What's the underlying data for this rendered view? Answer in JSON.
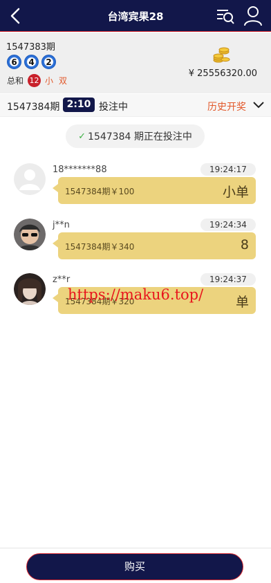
{
  "header": {
    "title": "台湾宾果28"
  },
  "last_draw": {
    "period": "1547383期",
    "balls": [
      "6",
      "4",
      "2"
    ],
    "sum_label": "总和",
    "sum_value": "12",
    "size_tag": "小",
    "parity_tag": "双",
    "balance": "¥ 25556320.00"
  },
  "current": {
    "period": "1547384期",
    "timer": "2:10",
    "status": "投注中",
    "history_link": "历史开奖"
  },
  "notice": {
    "text": "1547384 期正在投注中"
  },
  "messages": [
    {
      "user": "18*******88",
      "time": "19:24:17",
      "bet": "1547384期￥100",
      "pick": "小单"
    },
    {
      "user": "j**n",
      "time": "19:24:34",
      "bet": "1547384期￥340",
      "pick": "8"
    },
    {
      "user": "z**r",
      "time": "19:24:37",
      "bet": "1547384期￥320",
      "pick": "单"
    }
  ],
  "watermark": "https://maku6.top/",
  "footer": {
    "buy_label": "购买"
  },
  "colors": {
    "header_bg": "#12174a",
    "accent_red": "#d9282f",
    "bubble_gold": "#ecd37e",
    "link_orange": "#e2582a"
  }
}
